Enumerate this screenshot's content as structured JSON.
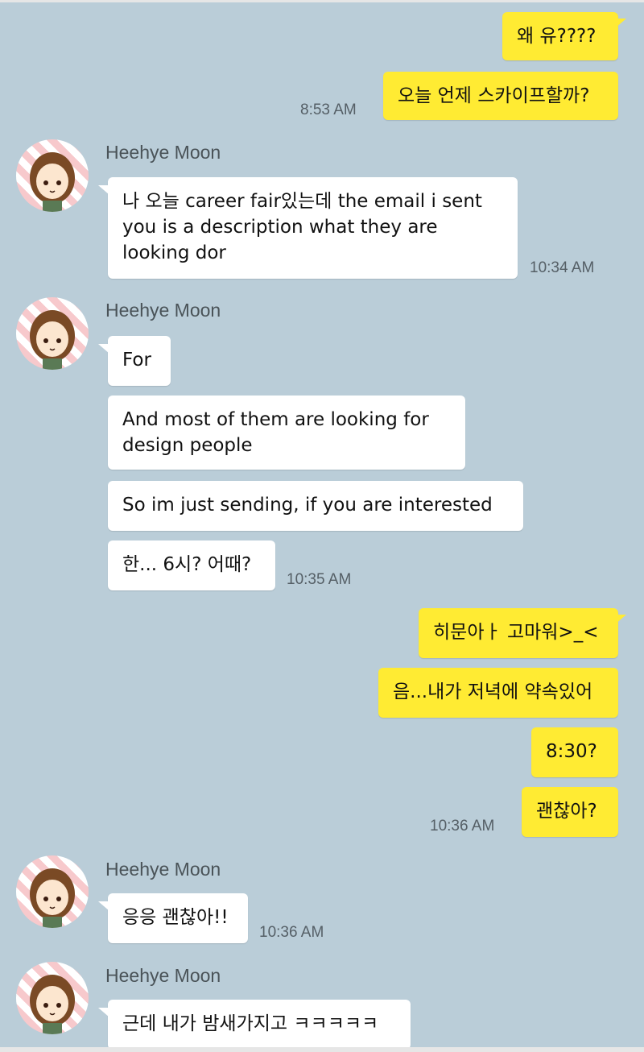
{
  "chat": {
    "sender_name": "Heehye Moon",
    "m1": "왜 유????",
    "m2": "오늘 언제 스카이프할까?",
    "t1": "8:53 AM",
    "g1_sender": "Heehye Moon",
    "g1_msg": "나 오늘 career fair있는데 the email i sent you is a description what they are looking dor",
    "t2": "10:34 AM",
    "g2_sender": "Heehye Moon",
    "g2_m1": "For",
    "g2_m2": "And most of them are looking for design people",
    "g2_m3": "So im just sending, if you are interested",
    "g2_m4": "한... 6시? 어때?",
    "t3": "10:35 AM",
    "m3": "히문아ㅏ 고마워>_<",
    "m4": "음...내가 저녁에 약속있어",
    "m5": "8:30?",
    "m6": "괜찮아?",
    "t4": "10:36 AM",
    "g3_sender": "Heehye Moon",
    "g3_msg": "응응 괜찮아!!",
    "t5": "10:36 AM",
    "g4_sender": "Heehye Moon",
    "g4_msg": "근데 내가 밤새가지고 ㅋㅋㅋㅋㅋ"
  },
  "colors": {
    "background": "#bacdd8",
    "my_bubble": "#ffeb33",
    "their_bubble": "#ffffff"
  },
  "icons": {
    "avatar": "profile-avatar-cartoon-girl"
  }
}
